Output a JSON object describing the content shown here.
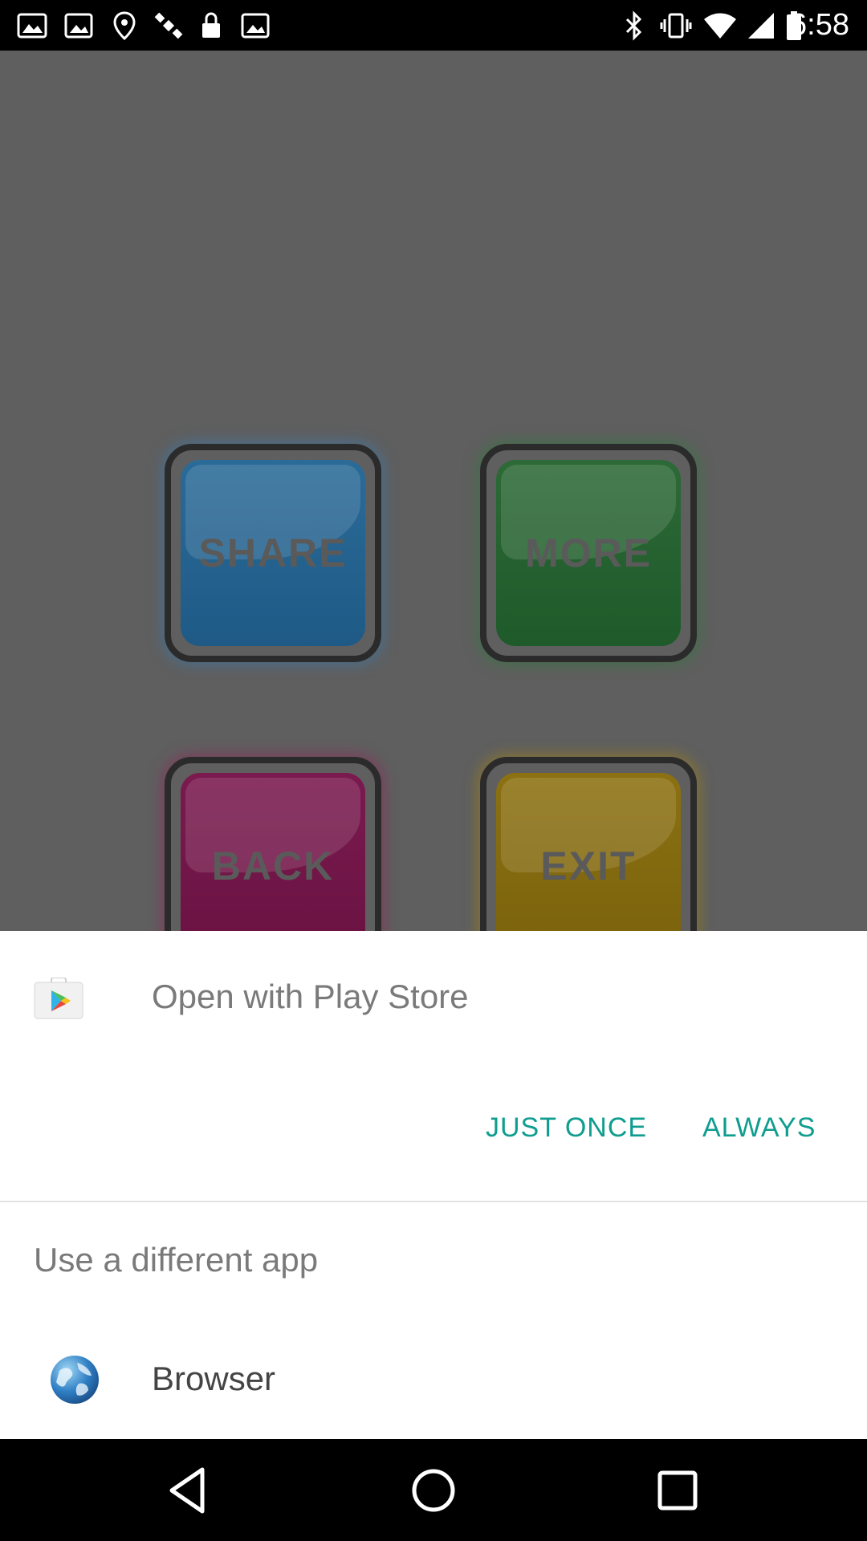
{
  "status_bar": {
    "time": "6:58",
    "left_icons": [
      "gallery-icon",
      "image-icon",
      "fake-gps-icon",
      "satellite-icon",
      "lock-icon",
      "image-icon"
    ],
    "right_icons": [
      "bluetooth-icon",
      "vibrate-icon",
      "wifi-icon",
      "signal-icon",
      "battery-icon"
    ]
  },
  "background_app": {
    "buttons": [
      {
        "label": "SHARE",
        "color": "#2b6b98"
      },
      {
        "label": "MORE",
        "color": "#2d6a37"
      },
      {
        "label": "BACK",
        "color": "#7a1a4f"
      },
      {
        "label": "EXIT",
        "color": "#8c7112"
      }
    ]
  },
  "dialog": {
    "title": "Open with Play Store",
    "app_icon": "play-store-icon",
    "actions": {
      "just_once": "JUST ONCE",
      "always": "ALWAYS"
    },
    "accent_color": "#0f9d8f",
    "other_section_title": "Use a different app",
    "other_apps": [
      {
        "label": "Browser",
        "icon": "globe-icon"
      }
    ]
  },
  "nav_bar": {
    "buttons": [
      "back-icon",
      "home-icon",
      "recents-icon"
    ]
  }
}
